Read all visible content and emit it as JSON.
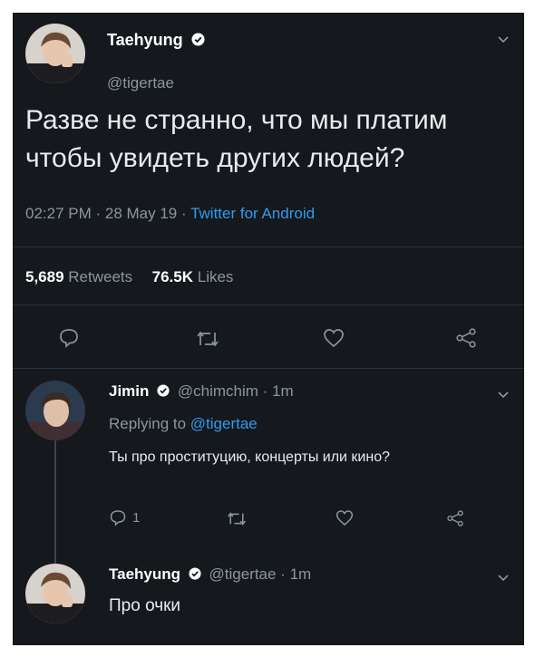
{
  "tweet": {
    "display_name": "Taehyung",
    "handle": "@tigertae",
    "text_line1": "Разве не странно, что мы платим",
    "text_line2": "чтобы увидеть других людей?",
    "time": "02:27 PM · 28 May 19 · ",
    "source": "Twitter for Android",
    "retweets_count": "5,689",
    "retweets_label": "Retweets",
    "likes_count": "76.5K",
    "likes_label": "Likes"
  },
  "reply1": {
    "display_name": "Jimin",
    "handle_time": "@chimchim · 1m",
    "replying_prefix": "Replying to ",
    "replying_handle": "@tigertae",
    "text": "Ты про проституцию, концерты или кино?",
    "reply_count": "1"
  },
  "reply2": {
    "display_name": "Taehyung",
    "handle_time": "@tigertae · 1m",
    "text": "Про очки"
  },
  "icons": {
    "verified": "verified-badge-icon",
    "chevron": "chevron-down-icon",
    "reply": "reply-icon",
    "retweet": "retweet-icon",
    "like": "heart-icon",
    "share": "share-icon"
  },
  "colors": {
    "background": "#15181c",
    "link": "#2f9bf0",
    "muted": "#8a96a1"
  }
}
